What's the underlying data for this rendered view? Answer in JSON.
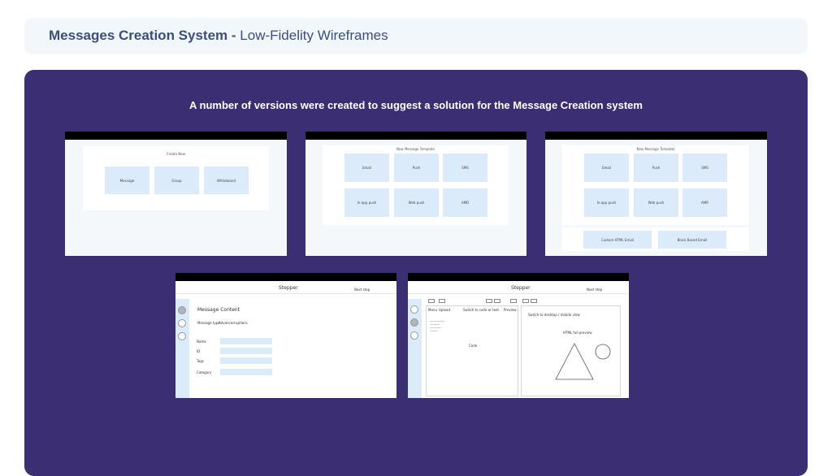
{
  "header": {
    "title_bold": "Messages Creation System -",
    "title_light": "Low-Fidelity Wireframes"
  },
  "panel": {
    "caption": "A number of versions were created to suggest a solution for the Message Creation system"
  },
  "wireframe1": {
    "title": "Create New",
    "tiles": [
      "Message",
      "Group",
      "Whiteboard"
    ]
  },
  "wireframe2": {
    "title": "New Message Template",
    "tiles": [
      "Email",
      "Push",
      "SMS",
      "In-app push",
      "Web push",
      "AMD"
    ]
  },
  "wireframe3": {
    "title": "New Message Template",
    "tiles": [
      "Email",
      "Push",
      "SMS",
      "In-app push",
      "Web push",
      "AMR"
    ],
    "extra_tiles": [
      "Custom HTML Email",
      "Block Based Email"
    ]
  },
  "wireframe4": {
    "stepper": "Stepper",
    "next": "Next step",
    "heading": "Message Content",
    "message_type": "Message type",
    "advanced": "Advanced options",
    "fields": [
      "Name",
      "ID",
      "Tags",
      "Category"
    ]
  },
  "wireframe5": {
    "stepper": "Stepper",
    "next": "Next step",
    "menu": "Menu",
    "upload": "Upload",
    "switch_code": "Switch to code or text",
    "preview": "Preview",
    "switch_device": "Switch to desktop / mobile view",
    "code": "Code",
    "html_preview": "HTML full preview"
  },
  "colors": {
    "panel": "#3c2e72",
    "header_bg": "#f2f7fb",
    "tile": "#dcebfa"
  }
}
